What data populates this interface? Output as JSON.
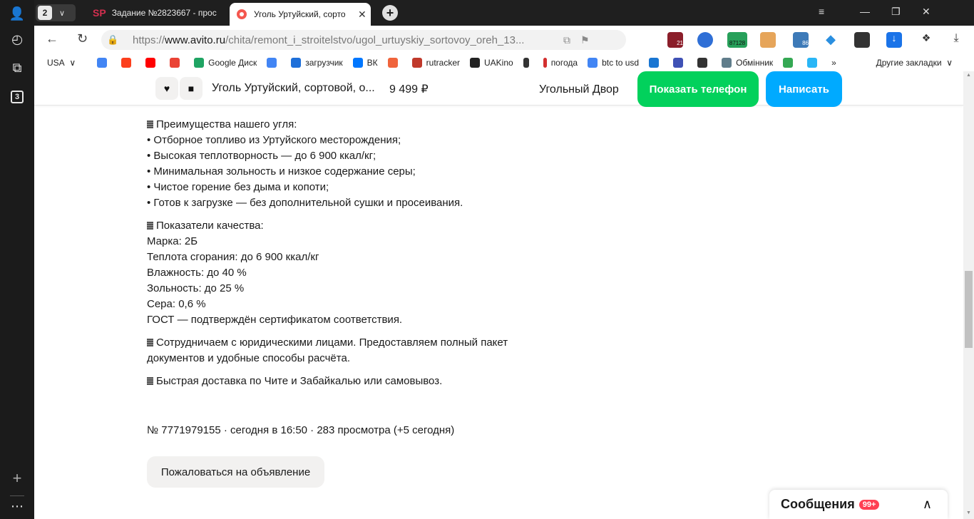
{
  "sidebar": {
    "tabs_count_badge": "3"
  },
  "tabs": {
    "count": "2",
    "items": [
      {
        "favicon": "SP",
        "title": "Задание №2823667 - прос"
      },
      {
        "title": "Уголь Уртуйский, сорто"
      }
    ]
  },
  "address": {
    "url_prefix": "https://",
    "url_host": "www.avito.ru",
    "url_path": "/chita/remont_i_stroitelstvo/ugol_urtuyskiy_sortovoy_oreh_13...",
    "ext_badges": [
      "21",
      "87128",
      "86"
    ]
  },
  "bookmarks": {
    "region": "USA",
    "items": [
      {
        "label": "",
        "color": "#4285f4",
        "icon": "google-icon"
      },
      {
        "label": "",
        "color": "#fc3f1d",
        "icon": "yandex-icon"
      },
      {
        "label": "",
        "color": "#ff0000",
        "icon": "youtube-icon"
      },
      {
        "label": "",
        "color": "#ea4335",
        "icon": "gmail-icon"
      },
      {
        "label": "Google Диск",
        "color": "#1fa463",
        "icon": "google-drive-icon"
      },
      {
        "label": "",
        "color": "#4285f4",
        "icon": "translate-icon"
      },
      {
        "label": "загрузчик",
        "color": "#1e6fd9",
        "icon": "loader-icon"
      },
      {
        "label": "ВК",
        "color": "#0077ff",
        "icon": "vk-icon"
      },
      {
        "label": "",
        "color": "#f0643c",
        "icon": "f-icon"
      },
      {
        "label": "rutracker",
        "color": "#c0392b",
        "icon": "rutracker-icon"
      },
      {
        "label": "UAKino",
        "color": "#222222",
        "icon": "uakino-icon"
      },
      {
        "label": "",
        "color": "#333333",
        "icon": "chess-icon"
      },
      {
        "label": "погода",
        "color": "#d32f2f",
        "icon": "thermometer-icon"
      },
      {
        "label": "btc to usd",
        "color": "#4285f4",
        "icon": "google-icon"
      },
      {
        "label": "",
        "color": "#1976d2",
        "icon": "p-icon"
      },
      {
        "label": "",
        "color": "#3f51b5",
        "icon": "arrow-icon"
      },
      {
        "label": "",
        "color": "#333333",
        "icon": "bc-icon"
      },
      {
        "label": "Обмінник",
        "color": "#607d8b",
        "icon": "exchange-icon"
      },
      {
        "label": "",
        "color": "#34a853",
        "icon": "maps-icon"
      },
      {
        "label": "",
        "color": "#29b6f6",
        "icon": "star-icon"
      }
    ],
    "overflow": "»",
    "other": "Другие закладки"
  },
  "sticky": {
    "title": "Уголь Уртуйский, сортовой, о...",
    "price": "9 499 ₽",
    "seller": "Угольный Двор",
    "phone_btn": "Показать телефон",
    "write_btn": "Написать"
  },
  "description": {
    "advantages_title": "Преимущества нашего угля:",
    "advantages": [
      "• Отборное топливо из Уртуйского месторождения;",
      "• Высокая теплотворность — до 6 900 ккал/кг;",
      "• Минимальная зольность и низкое содержание серы;",
      "• Чистое горение без дыма и копоти;",
      "• Готов к загрузке — без дополнительной сушки и просеивания."
    ],
    "quality_title": "Показатели качества:",
    "quality": [
      "Марка: 2Б",
      "Теплота сгорания: до 6 900 ккал/кг",
      "Влажность: до 40 %",
      "Зольность: до 25 %",
      "Сера: 0,6 %",
      "ГОСТ — подтверждён сертификатом соответствия."
    ],
    "legal_line1": "Сотрудничаем с юридическими лицами. Предоставляем полный пакет",
    "legal_line2": "документов и удобные способы расчёта.",
    "delivery": "Быстрая доставка по Чите и Забайкалью или самовывоз."
  },
  "meta": "№ 7771979155 · сегодня в 16:50 · 283 просмотра (+5 сегодня)",
  "report_btn": "Пожаловаться на объявление",
  "messages": {
    "label": "Сообщения",
    "badge": "99+"
  }
}
